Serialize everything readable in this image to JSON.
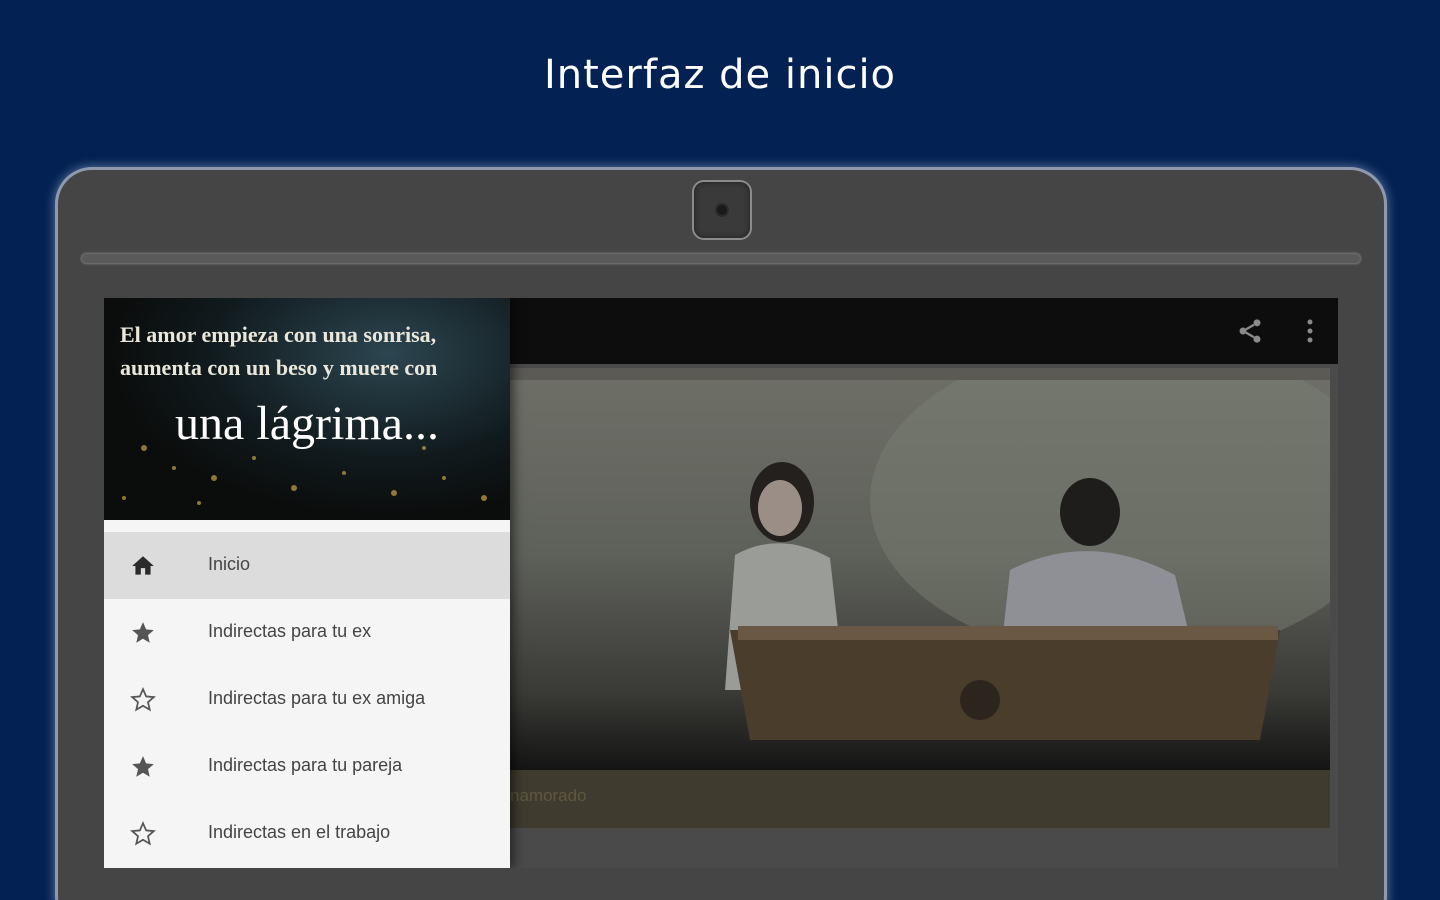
{
  "header": {
    "title": "Interfaz de inicio"
  },
  "drawer": {
    "quote_line1": "El amor empieza con una sonrisa,",
    "quote_line2": "aumenta con un beso y muere con",
    "quote_big": "una lágrima...",
    "items": [
      {
        "label": "Inicio",
        "icon": "home-icon",
        "active": true
      },
      {
        "label": "Indirectas para tu ex",
        "icon": "star-filled-icon"
      },
      {
        "label": "Indirectas para tu ex amiga",
        "icon": "star-outline-icon"
      },
      {
        "label": "Indirectas para tu pareja",
        "icon": "star-filled-icon"
      },
      {
        "label": "Indirectas en el trabajo",
        "icon": "star-outline-icon"
      }
    ]
  },
  "appbar": {
    "share_icon": "share-icon",
    "menu_icon": "more-vert-icon"
  },
  "content": {
    "caption": "namorado"
  },
  "colors": {
    "background": "#032253",
    "appbar": "#0d0d0d",
    "drawer": "#f5f5f5",
    "active_item": "#dcdcdc"
  }
}
